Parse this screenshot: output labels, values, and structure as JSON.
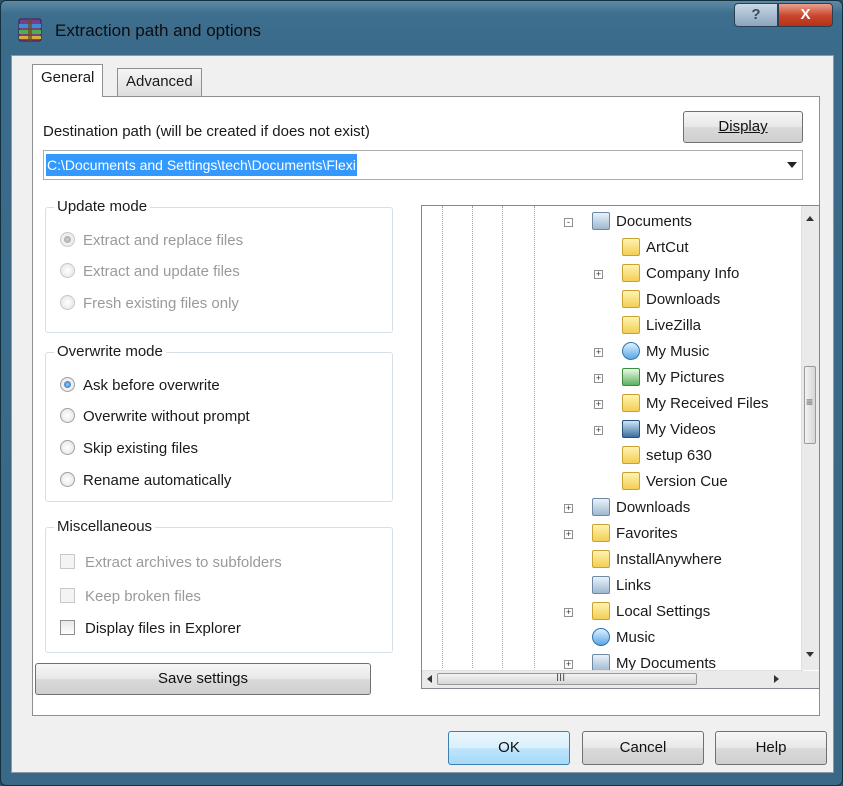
{
  "window": {
    "title": "Extraction path and options",
    "help_glyph": "?",
    "close_glyph": "X"
  },
  "tabs": [
    {
      "label": "General",
      "selected": true
    },
    {
      "label": "Advanced",
      "selected": false
    }
  ],
  "destination": {
    "label": "Destination path (will be created if does not exist)",
    "value": "C:\\Documents and Settings\\tech\\Documents\\Flexi",
    "display_button": "Display"
  },
  "update_mode": {
    "title": "Update mode",
    "options": [
      {
        "label": "Extract and replace files",
        "selected": true,
        "enabled": false
      },
      {
        "label": "Extract and update files",
        "selected": false,
        "enabled": false
      },
      {
        "label": "Fresh existing files only",
        "selected": false,
        "enabled": false
      }
    ]
  },
  "overwrite_mode": {
    "title": "Overwrite mode",
    "options": [
      {
        "label": "Ask before overwrite",
        "selected": true,
        "enabled": true
      },
      {
        "label": "Overwrite without prompt",
        "selected": false,
        "enabled": true
      },
      {
        "label": "Skip existing files",
        "selected": false,
        "enabled": true
      },
      {
        "label": "Rename automatically",
        "selected": false,
        "enabled": true
      }
    ]
  },
  "misc": {
    "title": "Miscellaneous",
    "options": [
      {
        "label": "Extract archives to subfolders",
        "checked": false,
        "enabled": false
      },
      {
        "label": "Keep broken files",
        "checked": false,
        "enabled": false
      },
      {
        "label": "Display files in Explorer",
        "checked": false,
        "enabled": true
      }
    ]
  },
  "save_settings": "Save settings",
  "tree": {
    "items": [
      {
        "label": "Documents",
        "icon": "documents-icon",
        "expander": "-"
      },
      {
        "label": "ArtCut",
        "icon": "folder-icon",
        "expander": ""
      },
      {
        "label": "Company Info",
        "icon": "folder-icon",
        "expander": "+"
      },
      {
        "label": "Downloads",
        "icon": "folder-icon",
        "expander": ""
      },
      {
        "label": "LiveZilla",
        "icon": "folder-icon",
        "expander": ""
      },
      {
        "label": "My Music",
        "icon": "music-folder-icon",
        "expander": "+"
      },
      {
        "label": "My Pictures",
        "icon": "pictures-folder-icon",
        "expander": "+"
      },
      {
        "label": "My Received Files",
        "icon": "folder-icon",
        "expander": "+"
      },
      {
        "label": "My Videos",
        "icon": "videos-folder-icon",
        "expander": "+"
      },
      {
        "label": "setup 630",
        "icon": "folder-icon",
        "expander": ""
      },
      {
        "label": "Version Cue",
        "icon": "folder-icon",
        "expander": ""
      },
      {
        "label": "Downloads",
        "icon": "documents-icon",
        "expander": "+"
      },
      {
        "label": "Favorites",
        "icon": "favorites-icon",
        "expander": "+"
      },
      {
        "label": "InstallAnywhere",
        "icon": "folder-icon",
        "expander": ""
      },
      {
        "label": "Links",
        "icon": "documents-icon",
        "expander": ""
      },
      {
        "label": "Local Settings",
        "icon": "folder-icon",
        "expander": "+"
      },
      {
        "label": "Music",
        "icon": "music-folder-icon",
        "expander": ""
      },
      {
        "label": "My Documents",
        "icon": "documents-icon",
        "expander": "+"
      }
    ],
    "hscroll_grip": "III",
    "vscroll_grip": "≡"
  },
  "footer": {
    "ok": "OK",
    "cancel": "Cancel",
    "help": "Help"
  }
}
